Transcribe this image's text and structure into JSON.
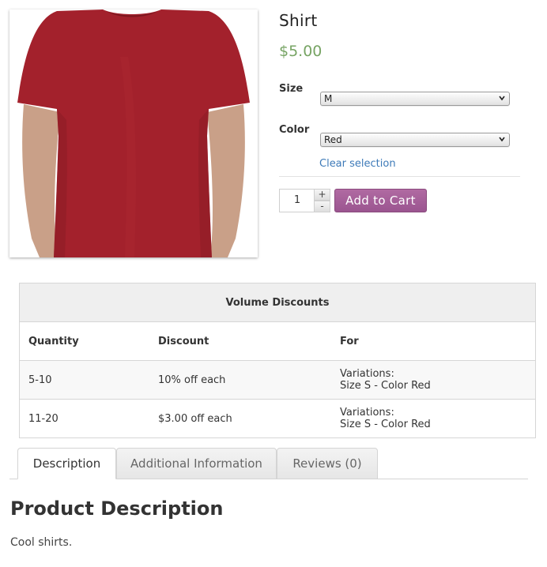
{
  "product": {
    "title": "Shirt",
    "price": "$5.00",
    "image_icon": "red-tshirt-photo"
  },
  "options": {
    "size": {
      "label": "Size",
      "selected": "M"
    },
    "color": {
      "label": "Color",
      "selected": "Red"
    },
    "clear_label": "Clear selection"
  },
  "cart": {
    "quantity": "1",
    "plus": "+",
    "minus": "-",
    "add_label": "Add to Cart"
  },
  "discounts": {
    "caption": "Volume Discounts",
    "headers": [
      "Quantity",
      "Discount",
      "For"
    ],
    "rows": [
      {
        "quantity": "5-10",
        "discount": "10% off each",
        "for_line1": "Variations:",
        "for_line2": "Size S - Color Red"
      },
      {
        "quantity": "11-20",
        "discount": "$3.00 off each",
        "for_line1": "Variations:",
        "for_line2": "Size S - Color Red"
      }
    ]
  },
  "tabs": [
    {
      "label": "Description"
    },
    {
      "label": "Additional Information"
    },
    {
      "label": "Reviews (0)"
    }
  ],
  "description": {
    "heading": "Product Description",
    "text": "Cool shirts."
  },
  "colors": {
    "price": "#77a464",
    "button": "#a15f97",
    "link": "#3d7ab8",
    "shirt": "#a3212c"
  }
}
